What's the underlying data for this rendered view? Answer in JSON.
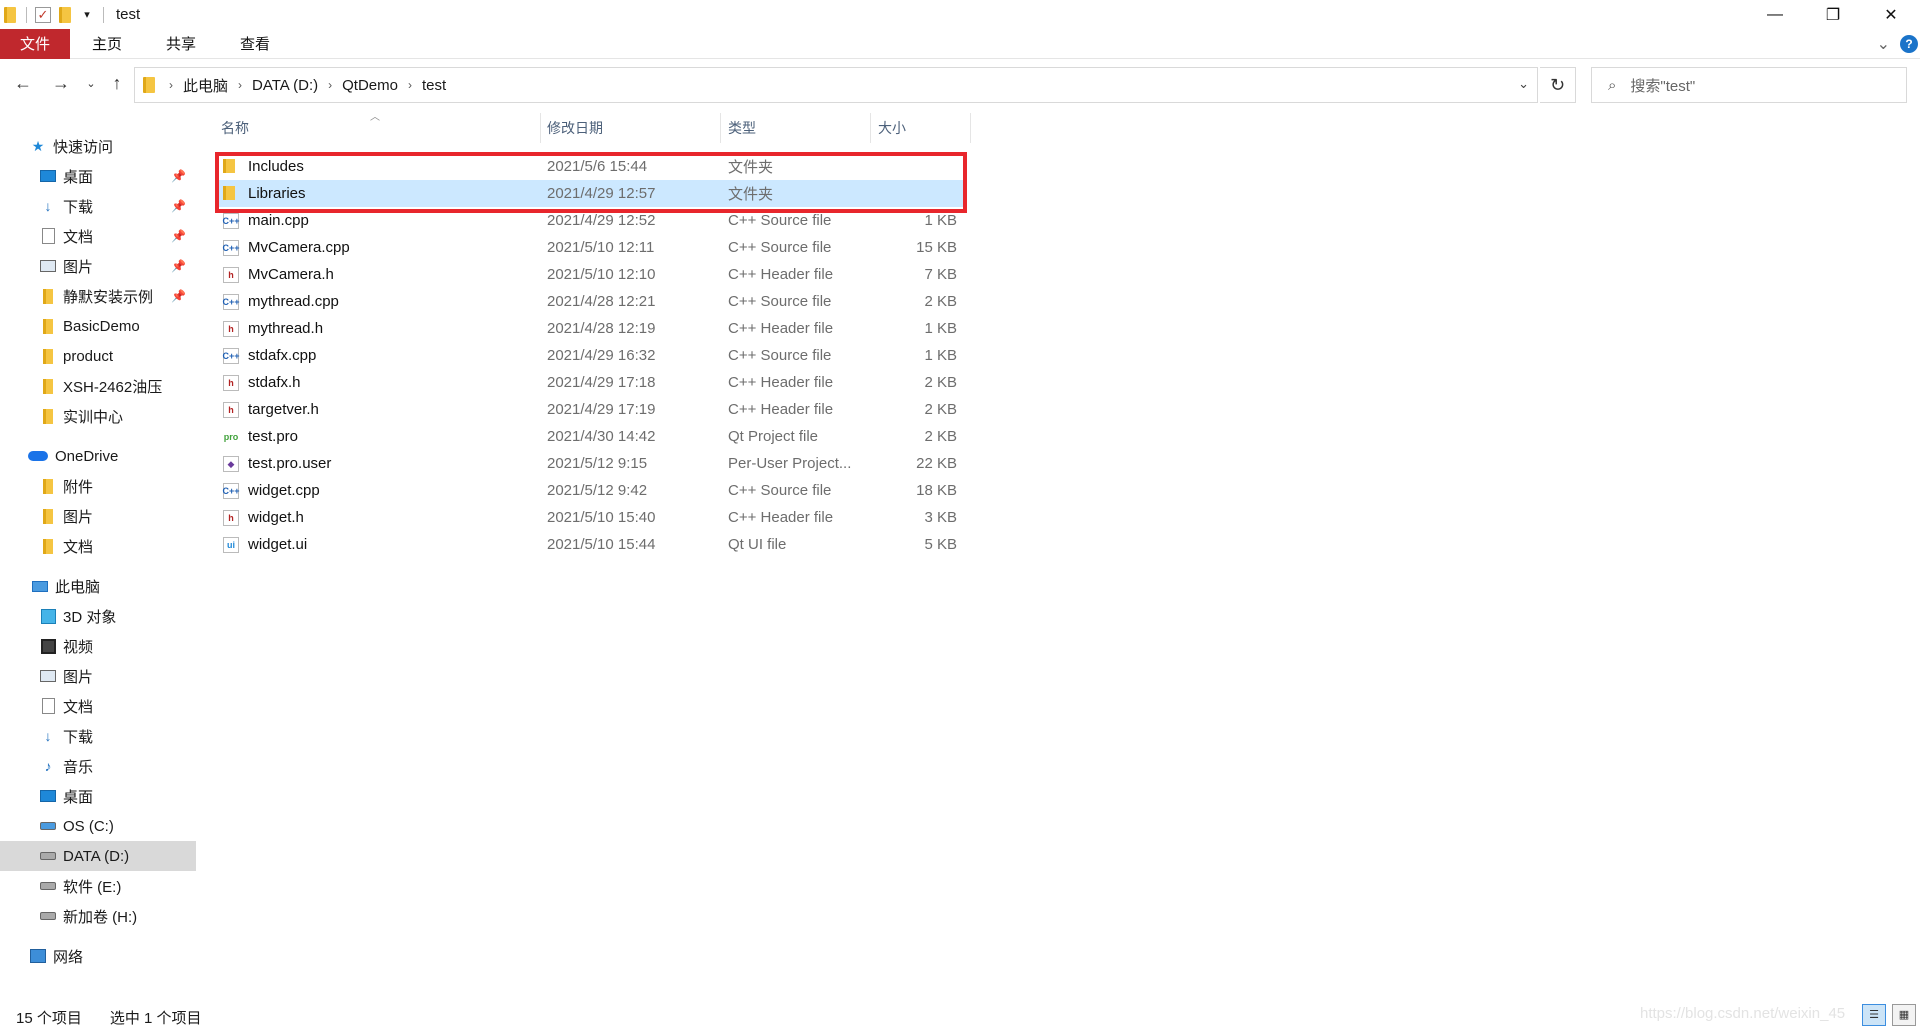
{
  "window": {
    "title": "test",
    "qa_dropdown": "▾",
    "controls": {
      "minimize": "—",
      "maximize": "❐",
      "close": "✕"
    }
  },
  "ribbon": {
    "tabs": [
      "文件",
      "主页",
      "共享",
      "查看"
    ],
    "expand": "⌄",
    "help": "?"
  },
  "address": {
    "crumbs": [
      "此电脑",
      "DATA (D:)",
      "QtDemo",
      "test"
    ],
    "search_placeholder": "搜索\"test\""
  },
  "nav": {
    "quick_access": "快速访问",
    "quick_items": [
      {
        "label": "桌面",
        "pinned": true
      },
      {
        "label": "下载",
        "pinned": true
      },
      {
        "label": "文档",
        "pinned": true
      },
      {
        "label": "图片",
        "pinned": true
      },
      {
        "label": "静默安装示例",
        "pinned": true
      },
      {
        "label": "BasicDemo",
        "pinned": false
      },
      {
        "label": "product",
        "pinned": false
      },
      {
        "label": "XSH-2462油压",
        "pinned": false
      },
      {
        "label": "实训中心",
        "pinned": false
      }
    ],
    "onedrive": "OneDrive",
    "onedrive_items": [
      "附件",
      "图片",
      "文档"
    ],
    "this_pc": "此电脑",
    "pc_items": [
      "3D 对象",
      "视频",
      "图片",
      "文档",
      "下载",
      "音乐",
      "桌面",
      "OS (C:)",
      "DATA (D:)",
      "软件 (E:)",
      "新加卷 (H:)"
    ],
    "network": "网络"
  },
  "columns": {
    "name": "名称",
    "date": "修改日期",
    "type": "类型",
    "size": "大小"
  },
  "files": [
    {
      "name": "Includes",
      "date": "2021/5/6 15:44",
      "type": "文件夹",
      "size": "",
      "icon": "folder"
    },
    {
      "name": "Libraries",
      "date": "2021/4/29 12:57",
      "type": "文件夹",
      "size": "",
      "icon": "folder"
    },
    {
      "name": "main.cpp",
      "date": "2021/4/29 12:52",
      "type": "C++ Source file",
      "size": "1 KB",
      "icon": "cpp"
    },
    {
      "name": "MvCamera.cpp",
      "date": "2021/5/10 12:11",
      "type": "C++ Source file",
      "size": "15 KB",
      "icon": "cpp"
    },
    {
      "name": "MvCamera.h",
      "date": "2021/5/10 12:10",
      "type": "C++ Header file",
      "size": "7 KB",
      "icon": "h"
    },
    {
      "name": "mythread.cpp",
      "date": "2021/4/28 12:21",
      "type": "C++ Source file",
      "size": "2 KB",
      "icon": "cpp"
    },
    {
      "name": "mythread.h",
      "date": "2021/4/28 12:19",
      "type": "C++ Header file",
      "size": "1 KB",
      "icon": "h"
    },
    {
      "name": "stdafx.cpp",
      "date": "2021/4/29 16:32",
      "type": "C++ Source file",
      "size": "1 KB",
      "icon": "cpp"
    },
    {
      "name": "stdafx.h",
      "date": "2021/4/29 17:18",
      "type": "C++ Header file",
      "size": "2 KB",
      "icon": "h"
    },
    {
      "name": "targetver.h",
      "date": "2021/4/29 17:19",
      "type": "C++ Header file",
      "size": "2 KB",
      "icon": "h"
    },
    {
      "name": "test.pro",
      "date": "2021/4/30 14:42",
      "type": "Qt Project file",
      "size": "2 KB",
      "icon": "pro"
    },
    {
      "name": "test.pro.user",
      "date": "2021/5/12 9:15",
      "type": "Per-User Project...",
      "size": "22 KB",
      "icon": "user"
    },
    {
      "name": "widget.cpp",
      "date": "2021/5/12 9:42",
      "type": "C++ Source file",
      "size": "18 KB",
      "icon": "cpp"
    },
    {
      "name": "widget.h",
      "date": "2021/5/10 15:40",
      "type": "C++ Header file",
      "size": "3 KB",
      "icon": "h"
    },
    {
      "name": "widget.ui",
      "date": "2021/5/10 15:44",
      "type": "Qt UI file",
      "size": "5 KB",
      "icon": "ui"
    }
  ],
  "status": {
    "count": "15 个项目",
    "selected": "选中 1 个项目",
    "watermark": "https://blog.csdn.net/weixin_45"
  },
  "colors": {
    "file_tab": "#c0282d",
    "selection": "#cce8ff",
    "highlight_box": "#e8262c"
  }
}
